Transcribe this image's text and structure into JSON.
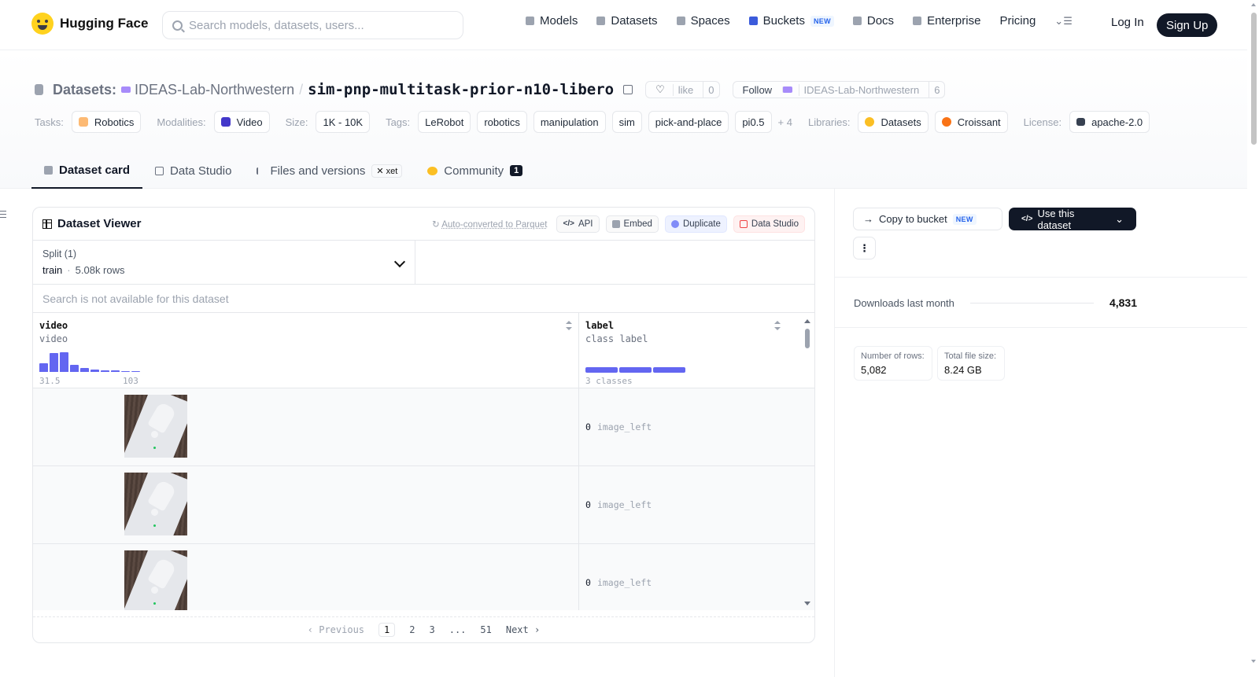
{
  "nav": {
    "brand": "Hugging Face",
    "search_placeholder": "Search models, datasets, users...",
    "items": [
      {
        "label": "Models",
        "icon": "cube-icon"
      },
      {
        "label": "Datasets",
        "icon": "database-icon"
      },
      {
        "label": "Spaces",
        "icon": "grid-icon"
      },
      {
        "label": "Buckets",
        "icon": "bucket-icon",
        "badge": "NEW"
      },
      {
        "label": "Docs",
        "icon": "book-icon"
      },
      {
        "label": "Enterprise",
        "icon": "enterprise-icon"
      },
      {
        "label": "Pricing"
      }
    ],
    "login": "Log In",
    "signup": "Sign Up"
  },
  "header": {
    "section": "Datasets:",
    "org": "IDEAS-Lab-Northwestern",
    "separator": "/",
    "name": "sim-pnp-multitask-prior-n10-libero",
    "like_label": "like",
    "like_count": "0",
    "follow_label": "Follow",
    "follow_org": "IDEAS-Lab-Northwestern",
    "follow_count": "6"
  },
  "tags": {
    "tasks_label": "Tasks:",
    "task": "Robotics",
    "modalities_label": "Modalities:",
    "modality": "Video",
    "size_label": "Size:",
    "size": "1K - 10K",
    "tags_label": "Tags:",
    "tag_list": [
      "LeRobot",
      "robotics",
      "manipulation",
      "sim",
      "pick-and-place",
      "pi0.5"
    ],
    "more": "+ 4",
    "libraries_label": "Libraries:",
    "libraries": [
      "Datasets",
      "Croissant"
    ],
    "license_label": "License:",
    "license": "apache-2.0"
  },
  "tabs": {
    "card": "Dataset card",
    "studio": "Data Studio",
    "files": "Files and versions",
    "xet": "xet",
    "community": "Community",
    "community_count": "1"
  },
  "viewer": {
    "title": "Dataset Viewer",
    "auto_converted": "Auto-converted to Parquet",
    "buttons": {
      "api": "API",
      "embed": "Embed",
      "duplicate": "Duplicate",
      "studio": "Data Studio"
    },
    "split_label": "Split (1)",
    "split_name": "train",
    "split_dot": "·",
    "split_rows": "5.08k rows",
    "search_unavailable": "Search is not available for this dataset",
    "columns": [
      {
        "name": "video",
        "type": "video",
        "hist_min": "31.5",
        "hist_max": "103"
      },
      {
        "name": "label",
        "type": "class label",
        "classes": "3 classes"
      }
    ],
    "histogram": [
      0.42,
      0.96,
      1.0,
      0.35,
      0.2,
      0.12,
      0.08,
      0.06,
      0.05,
      0.05
    ],
    "rows": [
      {
        "label_id": "0",
        "label_name": "image_left"
      },
      {
        "label_id": "0",
        "label_name": "image_left"
      },
      {
        "label_id": "0",
        "label_name": "image_left"
      }
    ],
    "pager": {
      "prev": "‹ Previous",
      "pages": [
        "1",
        "2",
        "3",
        "...",
        "51"
      ],
      "next": "Next ›"
    }
  },
  "sidebar": {
    "copy_bucket": "Copy to bucket",
    "copy_badge": "NEW",
    "use_dataset": "Use this dataset",
    "downloads_label": "Downloads last month",
    "downloads_value": "4,831",
    "rows_label": "Number of rows:",
    "rows_value": "5,082",
    "size_label": "Total file size:",
    "size_value": "8.24 GB"
  }
}
